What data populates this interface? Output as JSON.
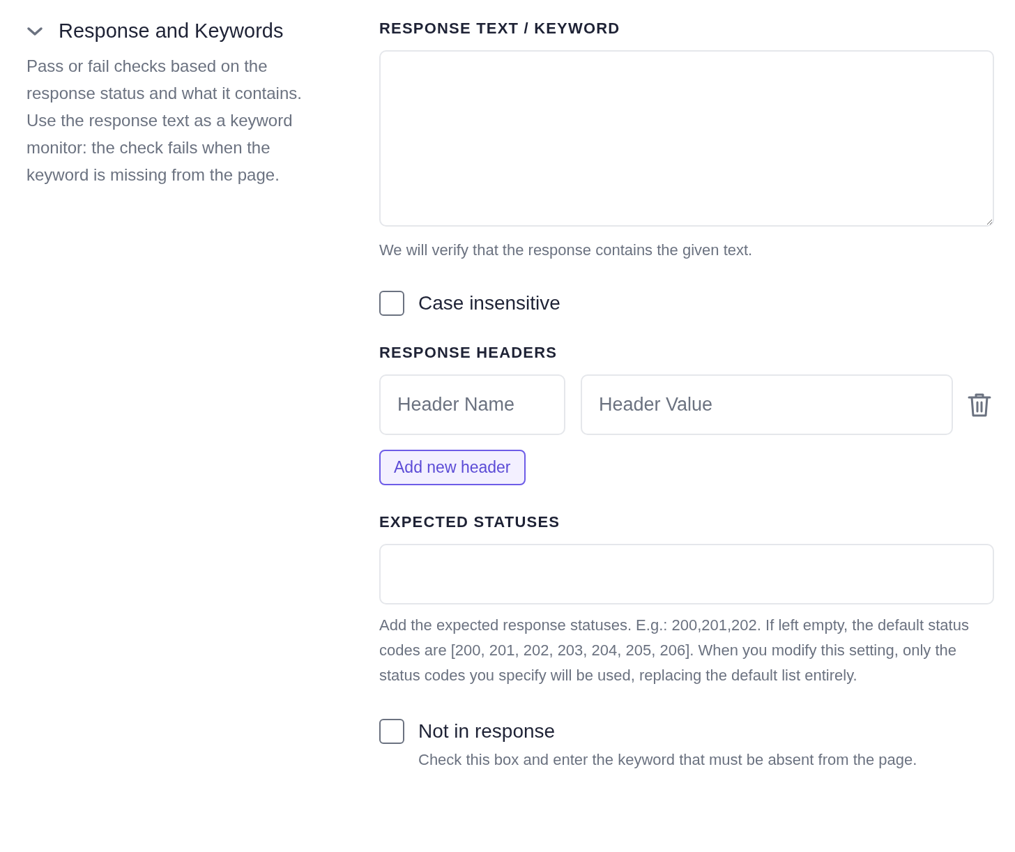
{
  "section": {
    "title": "Response and Keywords",
    "expanded": true,
    "description": "Pass or fail checks based on the response status and what it contains. Use the response text as a keyword monitor: the check fails when the keyword is missing from the page."
  },
  "response_text": {
    "label": "RESPONSE TEXT / KEYWORD",
    "help": "We will verify that the response contains the given text."
  },
  "case_insensitive": {
    "label": "Case insensitive",
    "checked": false
  },
  "response_headers": {
    "label": "RESPONSE HEADERS",
    "rows": [
      {
        "name_placeholder": "Header Name",
        "value_placeholder": "Header Value"
      }
    ],
    "add_button": "Add new header"
  },
  "expected_statuses": {
    "label": "EXPECTED STATUSES",
    "help": "Add the expected response statuses. E.g.: 200,201,202. If left empty, the default status codes are [200, 201, 202, 203, 204, 205, 206]. When you modify this setting, only the status codes you specify will be used, replacing the default list entirely."
  },
  "not_in_response": {
    "label": "Not in response",
    "checked": false,
    "description": "Check this box and enter the keyword that must be absent from the page."
  }
}
